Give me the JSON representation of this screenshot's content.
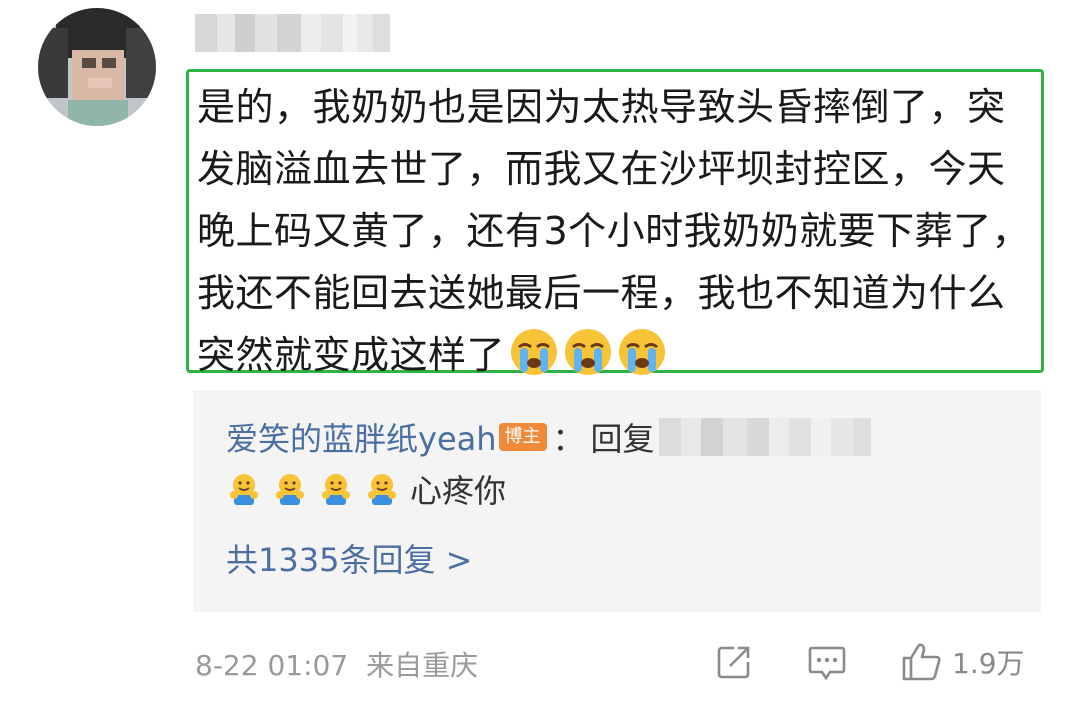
{
  "comment": {
    "avatar_icon": "avatar-image",
    "text": "是的，我奶奶也是因为太热导致头昏摔倒了，突发脑溢血去世了，而我又在沙坪坝封控区，今天晚上码又黄了，还有3个小时我奶奶就要下葬了，我还不能回去送她最后一程，我也不知道为什么突然就变成这样了",
    "emojis": [
      "crying-emoji",
      "crying-emoji",
      "crying-emoji"
    ],
    "highlight_color": "#2fb344"
  },
  "reply": {
    "author": "爱笑的蓝胖纸yeah",
    "badge": "博主",
    "colon": "：",
    "reply_label": "回复",
    "content": "心疼你",
    "hug_emojis": [
      "hug-emoji",
      "hug-emoji",
      "hug-emoji",
      "hug-emoji"
    ],
    "count_text": "共1335条回复 >"
  },
  "footer": {
    "date": "8-22 01:07",
    "location": "来自重庆",
    "like_count": "1.9万",
    "icons": [
      "share-icon",
      "comment-icon",
      "like-icon"
    ]
  },
  "colors": {
    "link_blue": "#4a6fa0",
    "badge_orange": "#f08a3a",
    "meta_gray": "#9a9a9a"
  }
}
